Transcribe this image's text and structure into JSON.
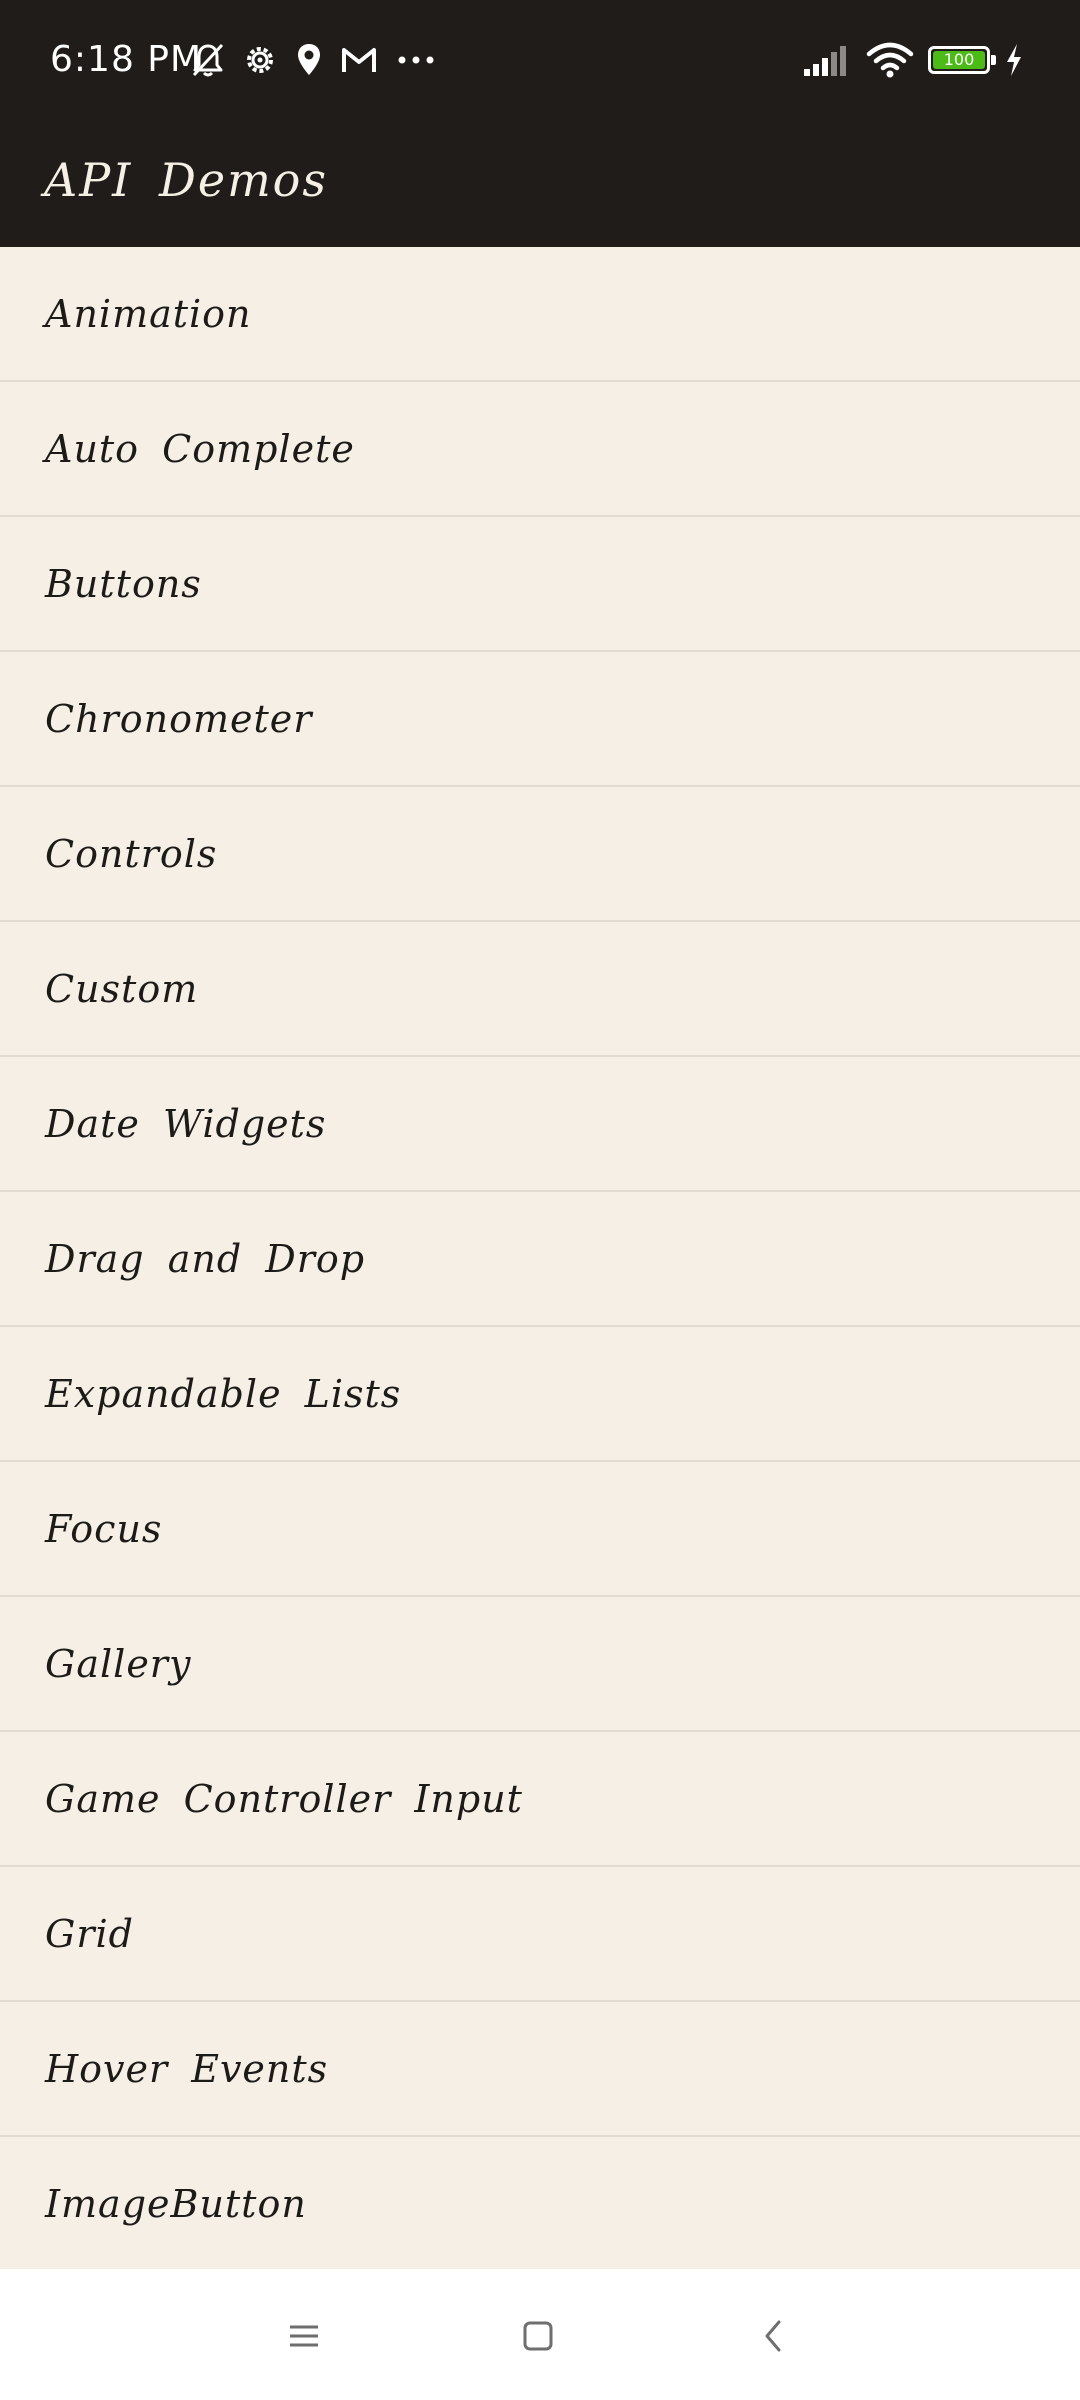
{
  "status_bar": {
    "time": "6:18 PM",
    "battery_level": "100",
    "icons": [
      "notifications-off-icon",
      "settings-gear-icon",
      "location-icon",
      "gmail-icon",
      "more-dots-icon",
      "signal-icon",
      "wifi-icon",
      "battery-icon",
      "charging-icon"
    ],
    "battery_color": "#4cbb17"
  },
  "app_bar": {
    "title": "API Demos",
    "background": "#1f1c19"
  },
  "list": {
    "background": "#f5efe6",
    "items": [
      {
        "label": "Animation"
      },
      {
        "label": "Auto Complete"
      },
      {
        "label": "Buttons"
      },
      {
        "label": "Chronometer"
      },
      {
        "label": "Controls"
      },
      {
        "label": "Custom"
      },
      {
        "label": "Date Widgets"
      },
      {
        "label": "Drag and Drop"
      },
      {
        "label": "Expandable Lists"
      },
      {
        "label": "Focus"
      },
      {
        "label": "Gallery"
      },
      {
        "label": "Game Controller Input"
      },
      {
        "label": "Grid"
      },
      {
        "label": "Hover Events"
      },
      {
        "label": "ImageButton"
      }
    ]
  },
  "nav_bar": {
    "buttons": [
      "menu-icon",
      "home-icon",
      "back-icon"
    ]
  }
}
